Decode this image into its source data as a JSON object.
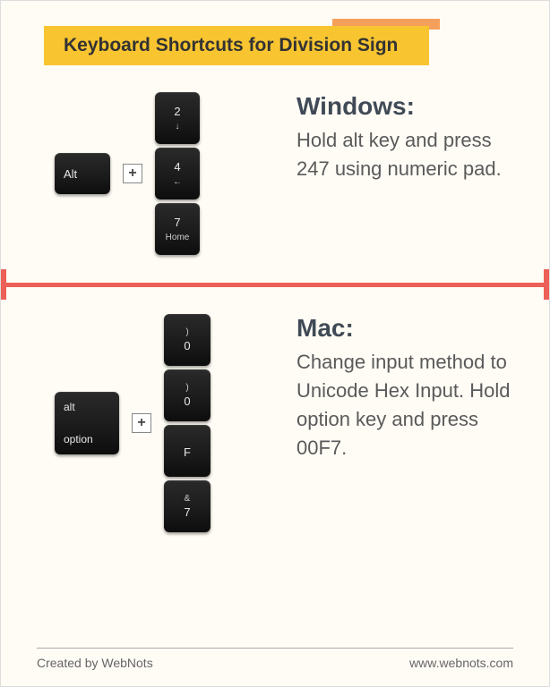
{
  "title": "Keyboard Shortcuts for Division Sign",
  "windows": {
    "heading": "Windows:",
    "body": "Hold alt key and press 247 using numeric pad.",
    "modifier": "Alt",
    "keys": [
      {
        "main": "2",
        "sub": "↓"
      },
      {
        "main": "4",
        "sub": "←"
      },
      {
        "main": "7",
        "sub": "Home"
      }
    ]
  },
  "mac": {
    "heading": "Mac:",
    "body": "Change input method to Unicode Hex Input. Hold option key and press 00F7.",
    "modifier_top": "alt",
    "modifier_bottom": "option",
    "keys": [
      {
        "top": ")",
        "bottom": "0"
      },
      {
        "top": ")",
        "bottom": "0"
      },
      {
        "top": "",
        "bottom": "F"
      },
      {
        "top": "&",
        "bottom": "7"
      }
    ]
  },
  "plus_symbol": "+",
  "footer": {
    "credit": "Created by WebNots",
    "url": "www.webnots.com"
  }
}
